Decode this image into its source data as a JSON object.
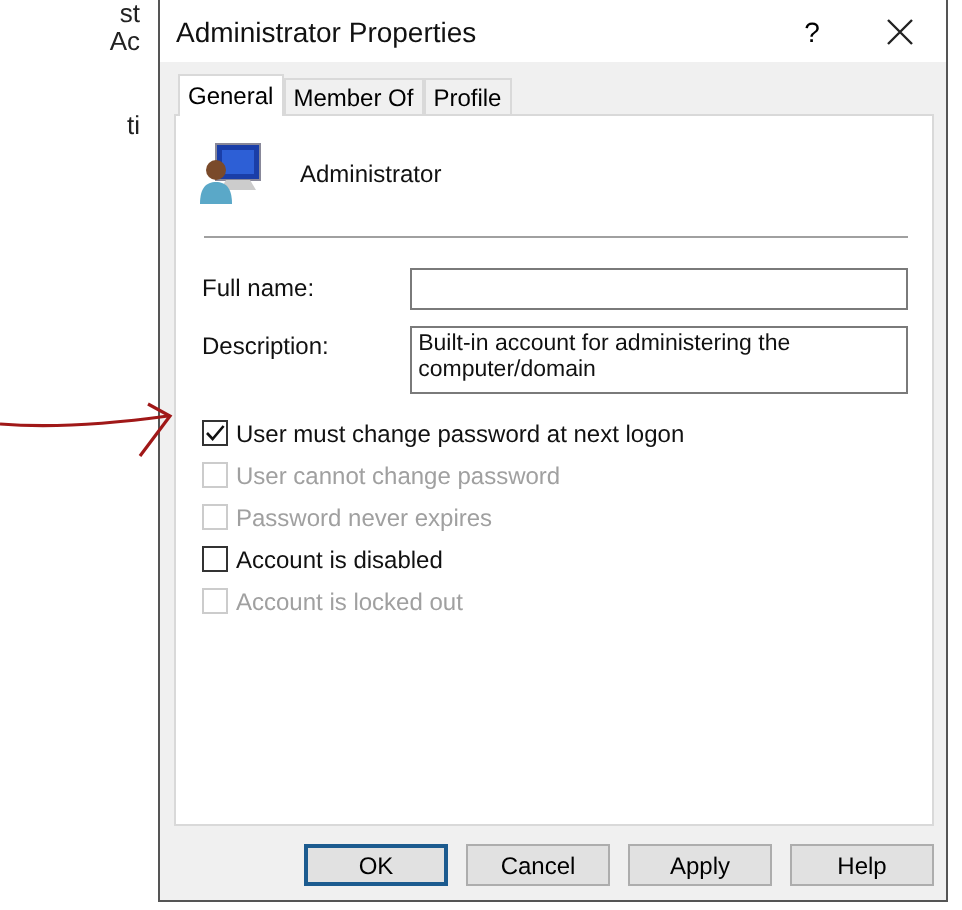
{
  "background_text": [
    "st",
    "Ac",
    "ti"
  ],
  "window": {
    "title": "Administrator Properties",
    "help": "?"
  },
  "tabs": [
    {
      "label": "General",
      "selected": true
    },
    {
      "label": "Member Of",
      "selected": false
    },
    {
      "label": "Profile",
      "selected": false
    }
  ],
  "account_name": "Administrator",
  "fields": [
    {
      "label": "Full name:",
      "kind": "line"
    },
    {
      "label": "Description:",
      "value": "Built-in account for administering the computer/domain",
      "kind": "area"
    }
  ],
  "checkboxes": [
    {
      "label": "User must change password at next logon",
      "checked": true,
      "disabled": false
    },
    {
      "label": "User cannot change password",
      "checked": false,
      "disabled": true
    },
    {
      "label": "Password never expires",
      "checked": false,
      "disabled": true
    },
    {
      "label": "Account is disabled",
      "checked": false,
      "disabled": false
    },
    {
      "label": "Account is locked out",
      "checked": false,
      "disabled": true
    }
  ],
  "buttons": [
    {
      "label": "OK",
      "default": true
    },
    {
      "label": "Cancel",
      "default": false
    },
    {
      "label": "Apply",
      "default": false
    },
    {
      "label": "Help",
      "default": false
    }
  ]
}
